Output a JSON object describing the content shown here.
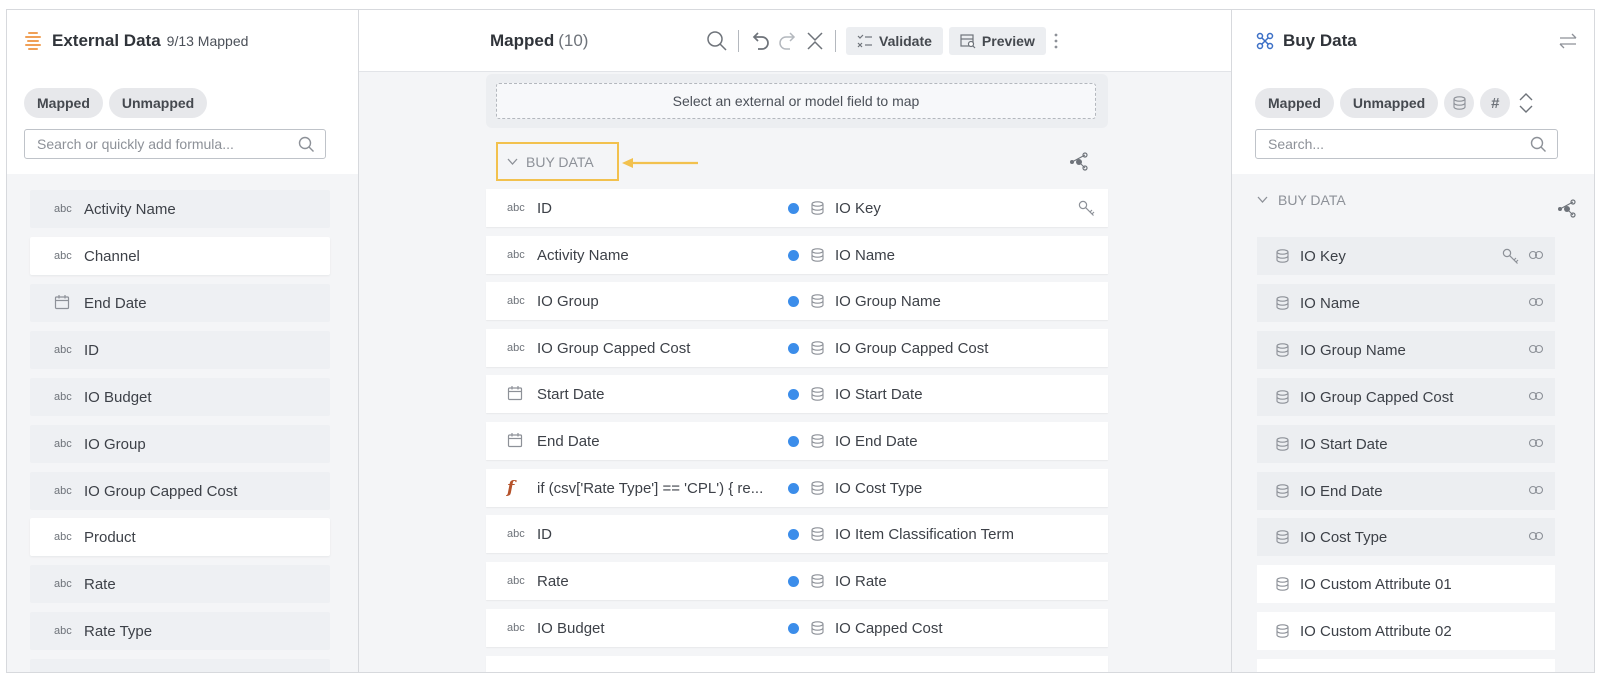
{
  "left": {
    "title": "External Data",
    "count": "9/13 Mapped",
    "filters": [
      "Mapped",
      "Unmapped"
    ],
    "search_placeholder": "Search or quickly add formula...",
    "items": [
      {
        "type": "abc",
        "label": "Activity Name"
      },
      {
        "type": "abc",
        "label": "Channel"
      },
      {
        "type": "date",
        "label": "End Date"
      },
      {
        "type": "abc",
        "label": "ID"
      },
      {
        "type": "abc",
        "label": "IO Budget"
      },
      {
        "type": "abc",
        "label": "IO Group"
      },
      {
        "type": "abc",
        "label": "IO Group Capped Cost"
      },
      {
        "type": "abc",
        "label": "Product"
      },
      {
        "type": "abc",
        "label": "Rate"
      },
      {
        "type": "abc",
        "label": "Rate Type"
      }
    ]
  },
  "center": {
    "title": "Mapped",
    "count": "(10)",
    "validate_label": "Validate",
    "preview_label": "Preview",
    "drop_hint": "Select an external or model field to map",
    "group_label": "BUY DATA",
    "mappings": [
      {
        "src_type": "abc",
        "source": "ID",
        "target": "IO Key"
      },
      {
        "src_type": "abc",
        "source": "Activity Name",
        "target": "IO Name"
      },
      {
        "src_type": "abc",
        "source": "IO Group",
        "target": "IO Group Name"
      },
      {
        "src_type": "abc",
        "source": "IO Group Capped Cost",
        "target": "IO Group Capped Cost"
      },
      {
        "src_type": "date",
        "source": "Start Date",
        "target": "IO Start Date"
      },
      {
        "src_type": "date",
        "source": "End Date",
        "target": "IO End Date"
      },
      {
        "src_type": "fn",
        "source": "if (csv['Rate Type'] == 'CPL') { re...",
        "target": "IO Cost Type"
      },
      {
        "src_type": "abc",
        "source": "ID",
        "target": "IO Item Classification Term"
      },
      {
        "src_type": "abc",
        "source": "Rate",
        "target": "IO Rate"
      },
      {
        "src_type": "abc",
        "source": "IO Budget",
        "target": "IO Capped Cost"
      }
    ]
  },
  "right": {
    "title": "Buy Data",
    "filters": [
      "Mapped",
      "Unmapped"
    ],
    "hash_label": "#",
    "search_placeholder": "Search...",
    "group_label": "BUY DATA",
    "items": [
      "IO Key",
      "IO Name",
      "IO Group Name",
      "IO Group Capped Cost",
      "IO Start Date",
      "IO End Date",
      "IO Cost Type",
      "IO Custom Attribute 01",
      "IO Custom Attribute 02"
    ]
  },
  "colors": {
    "accent_blue": "#3b8dea",
    "highlight_yellow": "#f2c14e",
    "brand_orange": "#f0a057",
    "flow_blue": "#d9e7f6"
  }
}
